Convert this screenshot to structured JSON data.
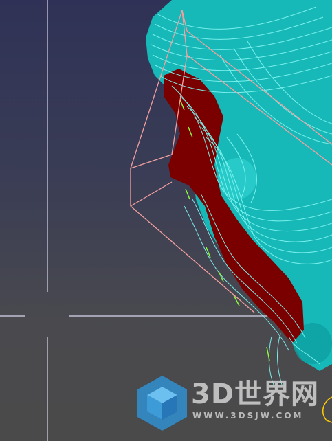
{
  "viewport": {
    "name": "3d-cad-viewport",
    "background_top": "#2f3256",
    "background_bottom": "#4a4a4a"
  },
  "colors": {
    "surface": "#17b8b8",
    "toolpath": "#7ef5f0",
    "toolpath_edge": "#8cff3c",
    "selected_region": "#7a0000",
    "bounding_box": "#f5a0a0",
    "crosshair": "#e8e8ff",
    "tool_marker": "#ffcc00"
  },
  "watermark": {
    "brand": "3D世界网",
    "url": "WWW.3DSJW.COM",
    "logo_icon": "cube-logo-icon",
    "logo_color": "#2f8fd0"
  }
}
